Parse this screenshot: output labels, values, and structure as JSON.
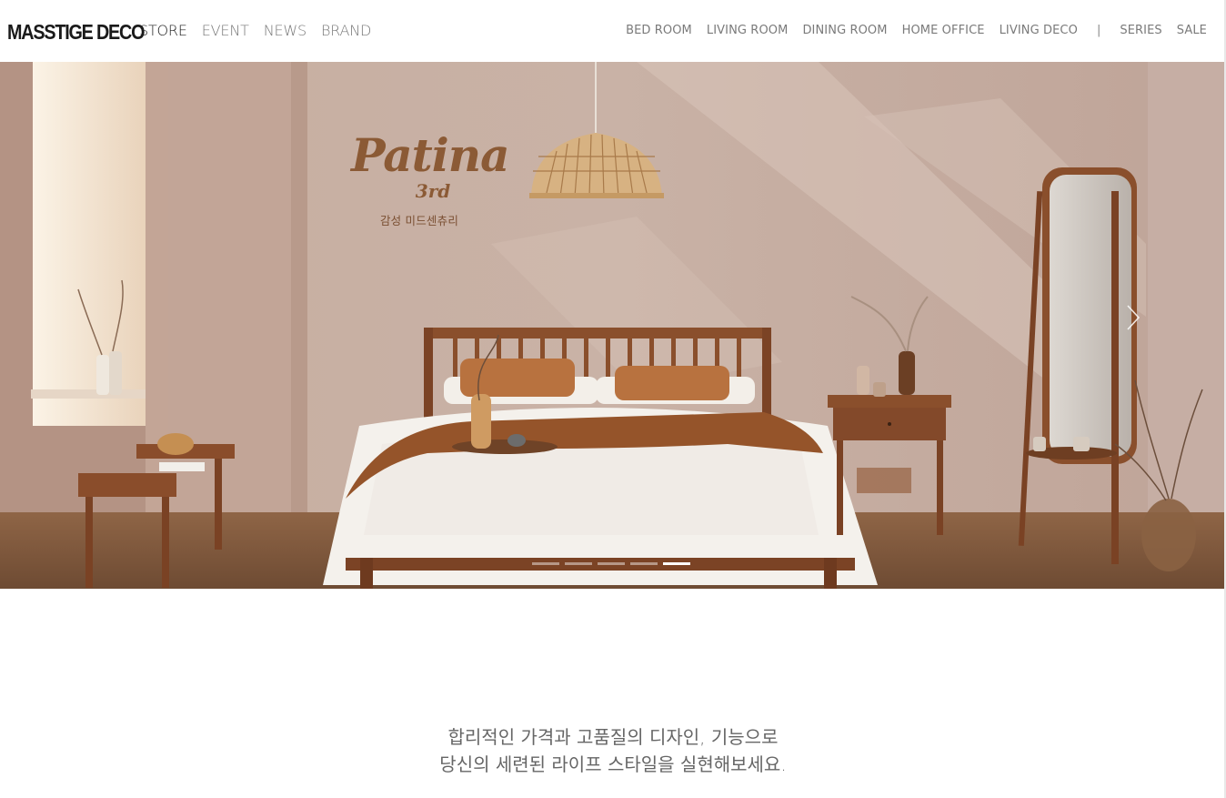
{
  "header": {
    "logo": "MASSTIGE DECO",
    "main_nav": [
      {
        "label": "STORE",
        "active": true
      },
      {
        "label": "EVENT",
        "active": false
      },
      {
        "label": "NEWS",
        "active": false
      },
      {
        "label": "BRAND",
        "active": false
      }
    ],
    "category_nav": [
      "BED ROOM",
      "LIVING ROOM",
      "DINING ROOM",
      "HOME OFFICE",
      "LIVING DECO"
    ],
    "separator": "|",
    "extra_nav": [
      "SERIES",
      "SALE"
    ]
  },
  "hero": {
    "collection_name": "Patina",
    "edition": "3rd",
    "tagline": "감성 미드센츄리",
    "slide_count": 5,
    "active_slide": 5,
    "next_icon": "chevron-right-icon"
  },
  "intro": {
    "line1": "합리적인 가격과 고품질의 디자인, 기능으로",
    "line2": "당신의 세련된 라이프 스타일을 실현해보세요."
  },
  "colors": {
    "wall": "#cdb8ad",
    "wood": "#8a4f2c",
    "accent_brown": "#8b5a35",
    "text_gray": "#666666"
  }
}
